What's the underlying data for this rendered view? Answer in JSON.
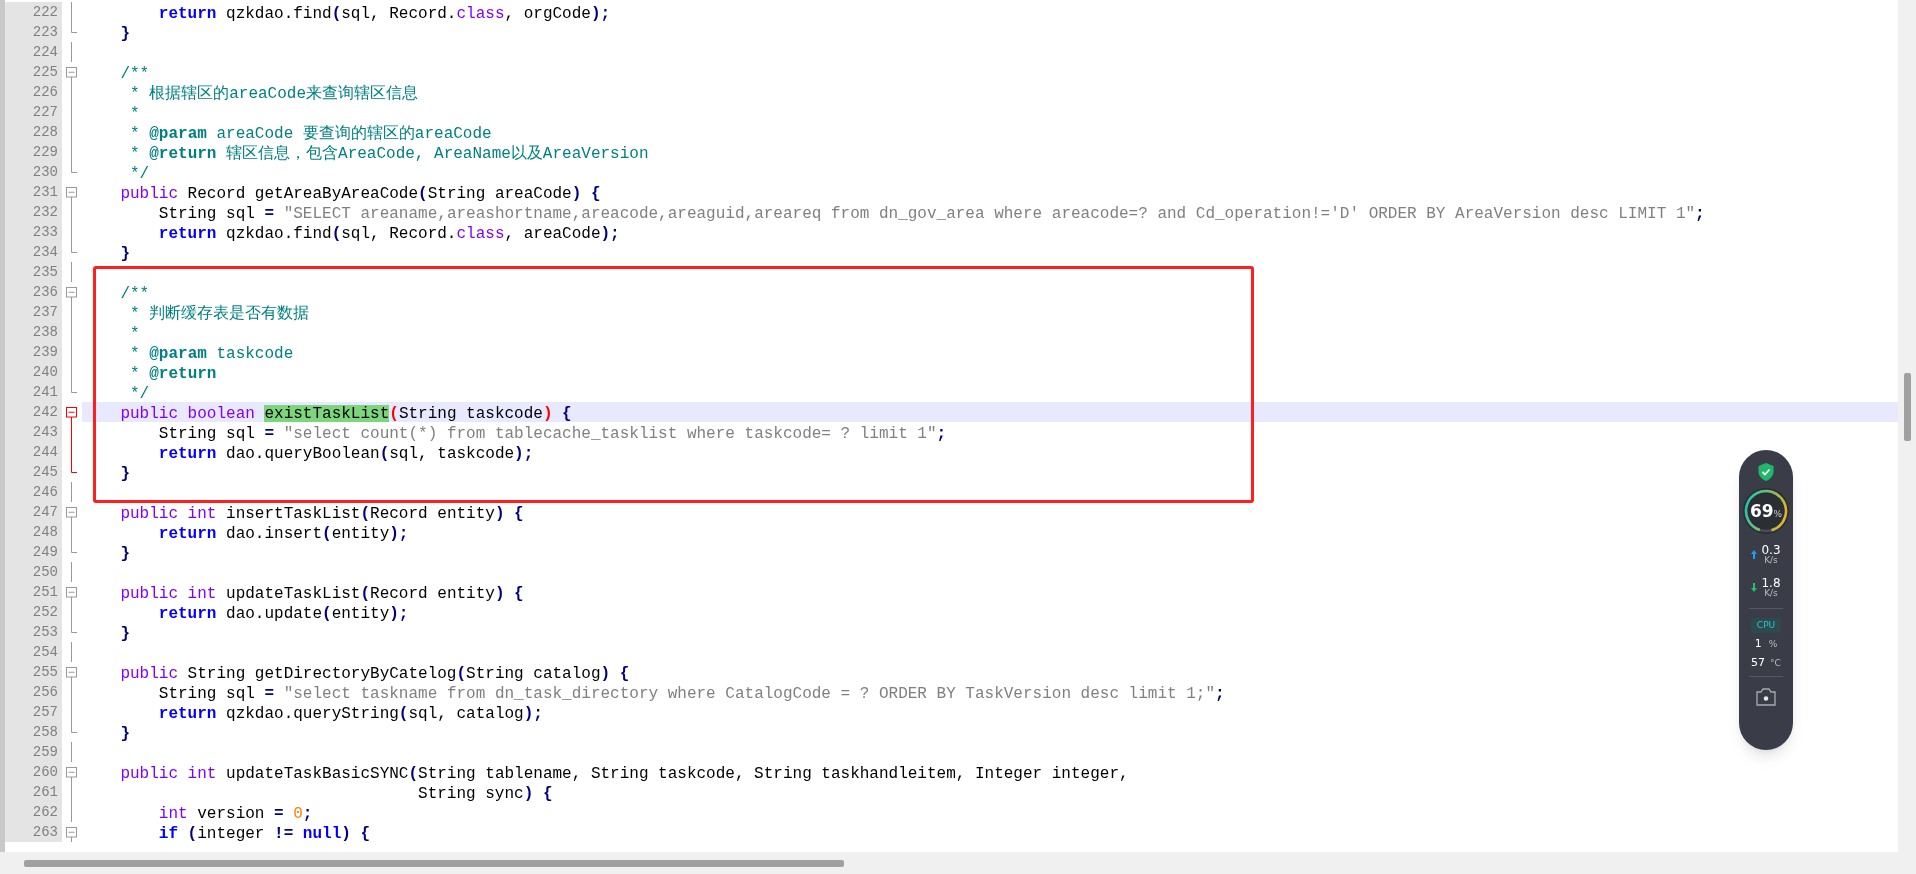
{
  "editor": {
    "lines": [
      {
        "number": "222",
        "selected": false,
        "fold": {
          "kind": "line",
          "active": false
        },
        "tokens": [
          {
            "kind": "keyword",
            "text": "        return"
          },
          {
            "kind": "plain",
            "text": " qzkdao.find"
          },
          {
            "kind": "operator",
            "text": "("
          },
          {
            "kind": "plain",
            "text": "sql, Record."
          },
          {
            "kind": "type",
            "text": "class"
          },
          {
            "kind": "plain",
            "text": ", orgCode"
          },
          {
            "kind": "operator",
            "text": ");"
          }
        ]
      },
      {
        "number": "223",
        "selected": false,
        "fold": {
          "kind": "end",
          "active": false
        },
        "tokens": [
          {
            "kind": "operator",
            "text": "    }"
          }
        ]
      },
      {
        "number": "224",
        "selected": false,
        "fold": {
          "kind": "line",
          "active": false
        }
      },
      {
        "number": "225",
        "selected": false,
        "fold": {
          "kind": "box",
          "active": false
        },
        "tokens": [
          {
            "kind": "comment",
            "text": "    /**"
          }
        ]
      },
      {
        "number": "226",
        "selected": false,
        "fold": {
          "kind": "line",
          "active": false
        },
        "tokens": [
          {
            "kind": "comment",
            "text": "     * 根据辖区的areaCode来查询辖区信息"
          }
        ]
      },
      {
        "number": "227",
        "selected": false,
        "fold": {
          "kind": "line",
          "active": false
        },
        "tokens": [
          {
            "kind": "comment",
            "text": "     *"
          }
        ]
      },
      {
        "number": "228",
        "selected": false,
        "fold": {
          "kind": "line",
          "active": false
        },
        "tokens": [
          {
            "kind": "comment",
            "text": "     * "
          },
          {
            "kind": "doctag",
            "text": "@param"
          },
          {
            "kind": "comment",
            "text": " areaCode 要查询的辖区的areaCode"
          }
        ]
      },
      {
        "number": "229",
        "selected": false,
        "fold": {
          "kind": "line",
          "active": false
        },
        "tokens": [
          {
            "kind": "comment",
            "text": "     * "
          },
          {
            "kind": "doctag",
            "text": "@return"
          },
          {
            "kind": "comment",
            "text": " 辖区信息，包含AreaCode, AreaName以及AreaVersion"
          }
        ]
      },
      {
        "number": "230",
        "selected": false,
        "fold": {
          "kind": "end",
          "active": false
        },
        "tokens": [
          {
            "kind": "comment",
            "text": "     */"
          }
        ]
      },
      {
        "number": "231",
        "selected": false,
        "fold": {
          "kind": "box",
          "active": false
        },
        "tokens": [
          {
            "kind": "type",
            "text": "    public"
          },
          {
            "kind": "plain",
            "text": " Record getAreaByAreaCode"
          },
          {
            "kind": "operator",
            "text": "("
          },
          {
            "kind": "plain",
            "text": "String areaCode"
          },
          {
            "kind": "operator",
            "text": ") {"
          }
        ]
      },
      {
        "number": "232",
        "selected": false,
        "fold": {
          "kind": "line",
          "active": false
        },
        "tokens": [
          {
            "kind": "plain",
            "text": "        String sql "
          },
          {
            "kind": "operator",
            "text": "="
          },
          {
            "kind": "string",
            "text": " \"SELECT areaname,areashortname,areacode,areaguid,areareq from dn_gov_area where areacode=? and Cd_operation!='D' ORDER BY AreaVersion desc LIMIT 1\""
          },
          {
            "kind": "operator",
            "text": ";"
          }
        ]
      },
      {
        "number": "233",
        "selected": false,
        "fold": {
          "kind": "line",
          "active": false
        },
        "tokens": [
          {
            "kind": "keyword",
            "text": "        return"
          },
          {
            "kind": "plain",
            "text": " qzkdao.find"
          },
          {
            "kind": "operator",
            "text": "("
          },
          {
            "kind": "plain",
            "text": "sql, Record."
          },
          {
            "kind": "type",
            "text": "class"
          },
          {
            "kind": "plain",
            "text": ", areaCode"
          },
          {
            "kind": "operator",
            "text": ");"
          }
        ]
      },
      {
        "number": "234",
        "selected": false,
        "fold": {
          "kind": "end",
          "active": false
        },
        "tokens": [
          {
            "kind": "operator",
            "text": "    }"
          }
        ]
      },
      {
        "number": "235",
        "selected": false,
        "fold": {
          "kind": "line",
          "active": false
        }
      },
      {
        "number": "236",
        "selected": false,
        "fold": {
          "kind": "box",
          "active": false
        },
        "tokens": [
          {
            "kind": "comment",
            "text": "    /**"
          }
        ]
      },
      {
        "number": "237",
        "selected": false,
        "fold": {
          "kind": "line",
          "active": false
        },
        "tokens": [
          {
            "kind": "comment",
            "text": "     * 判断缓存表是否有数据"
          }
        ]
      },
      {
        "number": "238",
        "selected": false,
        "fold": {
          "kind": "line",
          "active": false
        },
        "tokens": [
          {
            "kind": "comment",
            "text": "     *"
          }
        ]
      },
      {
        "number": "239",
        "selected": false,
        "fold": {
          "kind": "line",
          "active": false
        },
        "tokens": [
          {
            "kind": "comment",
            "text": "     * "
          },
          {
            "kind": "doctag",
            "text": "@param"
          },
          {
            "kind": "comment",
            "text": " taskcode"
          }
        ]
      },
      {
        "number": "240",
        "selected": false,
        "fold": {
          "kind": "line",
          "active": false
        },
        "tokens": [
          {
            "kind": "comment",
            "text": "     * "
          },
          {
            "kind": "doctag",
            "text": "@return"
          }
        ]
      },
      {
        "number": "241",
        "selected": false,
        "fold": {
          "kind": "end",
          "active": false
        },
        "tokens": [
          {
            "kind": "comment",
            "text": "     */"
          }
        ]
      },
      {
        "number": "242",
        "selected": true,
        "fold": {
          "kind": "box",
          "active": true
        },
        "tokens": [
          {
            "kind": "type",
            "text": "    public boolean "
          },
          {
            "kind": "match",
            "text": "existTaskList"
          },
          {
            "kind": "brace",
            "text": "("
          },
          {
            "kind": "plain",
            "text": "String taskcode"
          },
          {
            "kind": "brace",
            "text": ")"
          },
          {
            "kind": "operator",
            "text": " {"
          }
        ]
      },
      {
        "number": "243",
        "selected": false,
        "fold": {
          "kind": "line",
          "active": true
        },
        "tokens": [
          {
            "kind": "plain",
            "text": "        String sql "
          },
          {
            "kind": "operator",
            "text": "="
          },
          {
            "kind": "string",
            "text": " \"select count(*) from tablecache_tasklist where taskcode= ? limit 1\""
          },
          {
            "kind": "operator",
            "text": ";"
          }
        ]
      },
      {
        "number": "244",
        "selected": false,
        "fold": {
          "kind": "line",
          "active": true
        },
        "tokens": [
          {
            "kind": "keyword",
            "text": "        return"
          },
          {
            "kind": "plain",
            "text": " dao.queryBoolean"
          },
          {
            "kind": "operator",
            "text": "("
          },
          {
            "kind": "plain",
            "text": "sql, taskcode"
          },
          {
            "kind": "operator",
            "text": ");"
          }
        ]
      },
      {
        "number": "245",
        "selected": false,
        "fold": {
          "kind": "end",
          "active": true
        },
        "tokens": [
          {
            "kind": "operator",
            "text": "    }"
          }
        ]
      },
      {
        "number": "246",
        "selected": false,
        "fold": {
          "kind": "line",
          "active": false
        }
      },
      {
        "number": "247",
        "selected": false,
        "fold": {
          "kind": "box",
          "active": false
        },
        "tokens": [
          {
            "kind": "type",
            "text": "    public int"
          },
          {
            "kind": "plain",
            "text": " insertTaskList"
          },
          {
            "kind": "operator",
            "text": "("
          },
          {
            "kind": "plain",
            "text": "Record entity"
          },
          {
            "kind": "operator",
            "text": ") {"
          }
        ]
      },
      {
        "number": "248",
        "selected": false,
        "fold": {
          "kind": "line",
          "active": false
        },
        "tokens": [
          {
            "kind": "keyword",
            "text": "        return"
          },
          {
            "kind": "plain",
            "text": " dao.insert"
          },
          {
            "kind": "operator",
            "text": "("
          },
          {
            "kind": "plain",
            "text": "entity"
          },
          {
            "kind": "operator",
            "text": ");"
          }
        ]
      },
      {
        "number": "249",
        "selected": false,
        "fold": {
          "kind": "end",
          "active": false
        },
        "tokens": [
          {
            "kind": "operator",
            "text": "    }"
          }
        ]
      },
      {
        "number": "250",
        "selected": false,
        "fold": {
          "kind": "line",
          "active": false
        }
      },
      {
        "number": "251",
        "selected": false,
        "fold": {
          "kind": "box",
          "active": false
        },
        "tokens": [
          {
            "kind": "type",
            "text": "    public int"
          },
          {
            "kind": "plain",
            "text": " updateTaskList"
          },
          {
            "kind": "operator",
            "text": "("
          },
          {
            "kind": "plain",
            "text": "Record entity"
          },
          {
            "kind": "operator",
            "text": ") {"
          }
        ]
      },
      {
        "number": "252",
        "selected": false,
        "fold": {
          "kind": "line",
          "active": false
        },
        "tokens": [
          {
            "kind": "keyword",
            "text": "        return"
          },
          {
            "kind": "plain",
            "text": " dao.update"
          },
          {
            "kind": "operator",
            "text": "("
          },
          {
            "kind": "plain",
            "text": "entity"
          },
          {
            "kind": "operator",
            "text": ");"
          }
        ]
      },
      {
        "number": "253",
        "selected": false,
        "fold": {
          "kind": "end",
          "active": false
        },
        "tokens": [
          {
            "kind": "operator",
            "text": "    }"
          }
        ]
      },
      {
        "number": "254",
        "selected": false,
        "fold": {
          "kind": "line",
          "active": false
        }
      },
      {
        "number": "255",
        "selected": false,
        "fold": {
          "kind": "box",
          "active": false
        },
        "tokens": [
          {
            "kind": "type",
            "text": "    public"
          },
          {
            "kind": "plain",
            "text": " String getDirectoryByCatelog"
          },
          {
            "kind": "operator",
            "text": "("
          },
          {
            "kind": "plain",
            "text": "String catalog"
          },
          {
            "kind": "operator",
            "text": ") {"
          }
        ]
      },
      {
        "number": "256",
        "selected": false,
        "fold": {
          "kind": "line",
          "active": false
        },
        "tokens": [
          {
            "kind": "plain",
            "text": "        String sql "
          },
          {
            "kind": "operator",
            "text": "="
          },
          {
            "kind": "string",
            "text": " \"select taskname from dn_task_directory where CatalogCode = ? ORDER BY TaskVersion desc limit 1;\""
          },
          {
            "kind": "operator",
            "text": ";"
          }
        ]
      },
      {
        "number": "257",
        "selected": false,
        "fold": {
          "kind": "line",
          "active": false
        },
        "tokens": [
          {
            "kind": "keyword",
            "text": "        return"
          },
          {
            "kind": "plain",
            "text": " qzkdao.queryString"
          },
          {
            "kind": "operator",
            "text": "("
          },
          {
            "kind": "plain",
            "text": "sql, catalog"
          },
          {
            "kind": "operator",
            "text": ");"
          }
        ]
      },
      {
        "number": "258",
        "selected": false,
        "fold": {
          "kind": "end",
          "active": false
        },
        "tokens": [
          {
            "kind": "operator",
            "text": "    }"
          }
        ]
      },
      {
        "number": "259",
        "selected": false,
        "fold": {
          "kind": "line",
          "active": false
        }
      },
      {
        "number": "260",
        "selected": false,
        "fold": {
          "kind": "box",
          "active": false
        },
        "tokens": [
          {
            "kind": "type",
            "text": "    public int"
          },
          {
            "kind": "plain",
            "text": " updateTaskBasicSYNC"
          },
          {
            "kind": "operator",
            "text": "("
          },
          {
            "kind": "plain",
            "text": "String tablename, String taskcode, String taskhandleitem, Integer integer,"
          }
        ]
      },
      {
        "number": "261",
        "selected": false,
        "fold": {
          "kind": "line",
          "active": false
        },
        "tokens": [
          {
            "kind": "plain",
            "text": "                                   String sync"
          },
          {
            "kind": "operator",
            "text": ") {"
          }
        ]
      },
      {
        "number": "262",
        "selected": false,
        "fold": {
          "kind": "line",
          "active": false
        },
        "tokens": [
          {
            "kind": "type",
            "text": "        int"
          },
          {
            "kind": "plain",
            "text": " version "
          },
          {
            "kind": "operator",
            "text": "= "
          },
          {
            "kind": "number",
            "text": "0"
          },
          {
            "kind": "operator",
            "text": ";"
          }
        ]
      },
      {
        "number": "263",
        "selected": false,
        "fold": {
          "kind": "box",
          "active": false
        },
        "tokens": [
          {
            "kind": "keyword",
            "text": "        if"
          },
          {
            "kind": "operator",
            "text": " ("
          },
          {
            "kind": "plain",
            "text": "integer "
          },
          {
            "kind": "operator",
            "text": "!="
          },
          {
            "kind": "keyword",
            "text": " null"
          },
          {
            "kind": "operator",
            "text": ") {"
          }
        ]
      }
    ]
  },
  "monitor": {
    "memory": {
      "value": "69",
      "unit": "%"
    },
    "upload": {
      "value": "0.3",
      "unit": "K/s"
    },
    "download": {
      "value": "1.8",
      "unit": "K/s"
    },
    "cpu_label": "CPU",
    "cpu_usage": {
      "value": "1",
      "unit": "%"
    },
    "temperature": {
      "value": "57",
      "unit": "°C"
    }
  }
}
